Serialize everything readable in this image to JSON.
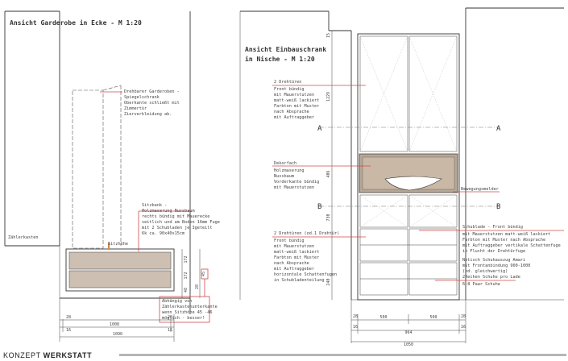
{
  "left_view": {
    "title": "Ansicht Garderobe in Ecke - M 1:20",
    "note_mirror": [
      "Drehbarer Garderoben -",
      "Spiegelschrank",
      "Oberkante schließt mit",
      "Zimmertür",
      "Zierverkleidung ab."
    ],
    "note_bench": [
      "Sitzbank -",
      "Holzmaserung Nussbaum",
      "rechts bündig mit Mauerecke",
      "seitlich und am Boden 16mm Fuge",
      "mit 2 Schubladen je 3geteilt",
      "6k ca. 90x40x15cm"
    ],
    "label_meter": "Zählerkasten",
    "label_seat": "Sitzhöhe",
    "note_warning": [
      "Abhängig von",
      "Zählerkastenunterkante",
      "wenn Sitzhöhe 45 -46",
      "möglich - besser!"
    ],
    "dims_vertical": [
      "172",
      "172",
      "48",
      "28",
      "45"
    ],
    "dims_horizontal": {
      "left": "28",
      "mid": "1008",
      "right": "28",
      "left2": "16",
      "right2": "16",
      "total": "1090"
    }
  },
  "right_view": {
    "title_line1": "Ansicht Einbauschrank",
    "title_line2": "in Nische - M 1:20",
    "note_doors": [
      "2 Drehtüren",
      "Front bündig",
      "mit Mauerstutzen",
      "matt-weiß lackiert",
      "Farbton mit Muster",
      "nach Absprache",
      "mit Auftraggeber"
    ],
    "note_niche": [
      "Dekorfach",
      "Holzmaserung",
      "Nussbaum",
      "Vorderkante bündig",
      "mit Mauerstutzen"
    ],
    "note_motion": "Bewegungsmelder",
    "note_lower": [
      "2 Drehtüren (od.1 Drehtür)",
      "Front bündig",
      "mit Mauerstutzen",
      "matt-weiß lackiert",
      "Farbton mit Muster",
      "nach Absprache",
      "mit Auftraggeber",
      "horizontale Schattenfugen",
      "in Schubladenteilung"
    ],
    "note_drawer": [
      "Schublade - Front bündig",
      "mit Mauerstutzen matt-weiß lackiert",
      "Farbton mit Muster nach Absprache",
      "mit Auftraggeber vertikale Schattenfuge",
      "in Flucht der Drehtürfuge"
    ],
    "note_shoes": [
      "Netisch Schuhauszug Amari",
      "mit Frontanbindung 900-1000",
      "(od. gleichwertig)",
      "2Reihen Schuhe pro Lade",
      "6-8 Paar Schuhe"
    ],
    "section_a": "A",
    "section_b": "B",
    "dims_vertical": [
      "15",
      "1229",
      "406",
      "730",
      "240"
    ],
    "dims_horizontal": {
      "left": "28",
      "d1": "500",
      "d2": "500",
      "right": "28",
      "left2": "16",
      "mid": "964",
      "right2": "16",
      "total": "1050"
    }
  },
  "footer": {
    "brand_light": "KONZEPT",
    "brand_bold": "WERKSTATT"
  }
}
